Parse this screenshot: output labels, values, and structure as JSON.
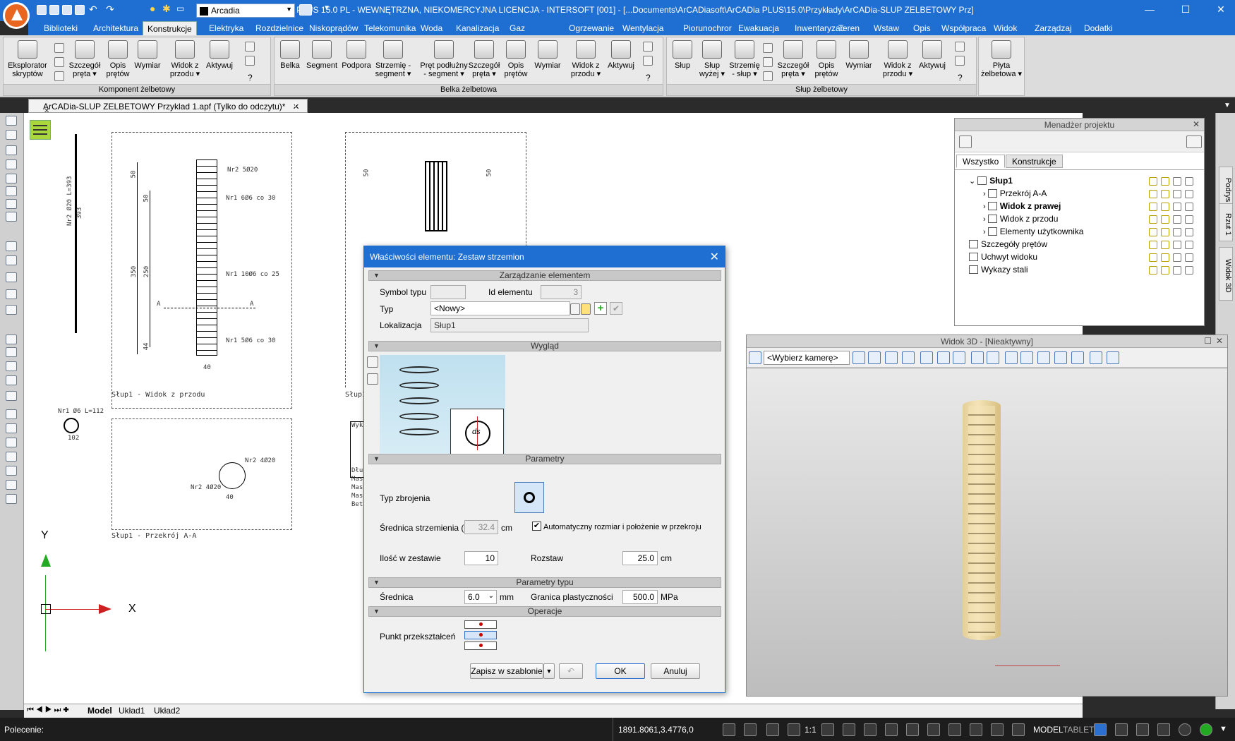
{
  "app": {
    "title": "ArCADia PLUS 15.0 PL - WEWNĘTRZNA, NIEKOMERCYJNA LICENCJA - INTERSOFT [001] - [...Documents\\ArCADiasoft\\ArCADia PLUS\\15.0\\Przykłady\\ArCADia-SLUP ZELBETOWY Prz]",
    "layer": "Arcadia"
  },
  "menu": [
    "Biblioteki",
    "Architektura",
    "Konstrukcje",
    "Elektryka",
    "Rozdzielnice",
    "Niskoprądów",
    "Telekomunika",
    "Woda",
    "Kanalizacja",
    "Gaz",
    "Ogrzewanie",
    "Wentylacja",
    "Piorunochror",
    "Ewakuacja",
    "Inwentaryzac",
    "Teren",
    "Wstaw",
    "Opis",
    "Współpraca",
    "Widok",
    "Zarządzaj",
    "Dodatki"
  ],
  "ribbon": {
    "g1": {
      "label": "Komponent żelbetowy",
      "b1": "Eksplorator",
      "b1b": "skryptów",
      "b2": "Szczegół",
      "b2b": "pręta ▾",
      "b3": "Opis",
      "b3b": "prętów",
      "b4": "Wymiar",
      "b5": "Widok z",
      "b5b": "przodu ▾",
      "b6": "Aktywuj",
      "b7": "?"
    },
    "g2": {
      "label": "Belka żelbetowa",
      "b1": "Belka",
      "b2": "Segment",
      "b3": "Podpora",
      "b4": "Strzemię -",
      "b4b": "segment ▾",
      "b5": "Pręt podłużny",
      "b5b": "- segment ▾",
      "b6": "Szczegół",
      "b6b": "pręta ▾",
      "b7": "Opis",
      "b7b": "prętów",
      "b8": "Wymiar",
      "b9": "Widok z",
      "b9b": "przodu ▾",
      "b10": "Aktywuj",
      "b11": "?"
    },
    "g3": {
      "label": "Słup żelbetowy",
      "b1": "Słup",
      "b2": "Słup",
      "b2b": "wyżej ▾",
      "b3": "Strzemię",
      "b3b": "- słup ▾",
      "b4": "Szczegół",
      "b4b": "pręta ▾",
      "b5": "Opis",
      "b5b": "prętów",
      "b6": "Wymiar",
      "b7": "Widok z",
      "b7b": "przodu ▾",
      "b8": "Aktywuj",
      "b9": "?"
    },
    "g4": {
      "b1": "Płyta",
      "b1b": "żelbetowa ▾"
    }
  },
  "doc_tab": "ArCADia-SLUP ZELBETOWY Przyklad 1.apf (Tylko do odczytu)*",
  "drawing": {
    "front_caption": "Słup1 - Widok z przodu",
    "right_caption": "Słup1",
    "section_caption": "Słup1 - Przekrój A-A",
    "dim_350": "350",
    "dim_250": "250",
    "dim_50a": "50",
    "dim_50b": "50",
    "dim_44": "44",
    "dim_40": "40",
    "dim_40b": "40",
    "n1": "Nr2 5Ø20",
    "n2": "Nr1 6Ø6 co 30",
    "n3": "Nr1 10Ø6 co 25",
    "n4": "Nr1 5Ø6 co 30",
    "vbar": "Nr2 Ø20 L=393",
    "vbar2": "393",
    "ring": "Nr1 Ø6 L=112",
    "ring2": "102",
    "sec_a": "A",
    "sec_b": "A",
    "s1": "Nr2 4Ø20",
    "s2": "Nr2 4Ø20",
    "tbl": "Wyk",
    "tbl2": "Dłu",
    "tbl3": "Mas",
    "tbl4": "Mas",
    "tbl5": "Mas",
    "tbl6": "Bet",
    "axis_y": "Y",
    "axis_x": "X"
  },
  "project_manager": {
    "title": "Menadżer projektu",
    "tabs": [
      "Wszystko",
      "Konstrukcje"
    ],
    "items": [
      "Słup1",
      "Przekrój A-A",
      "Widok z prawej",
      "Widok z przodu",
      "Elementy użytkownika",
      "Szczegóły prętów",
      "Uchwyt widoku",
      "Wykazy stali"
    ]
  },
  "right_tabs": [
    "Podrys",
    "Rzut 1",
    "Widok 3D"
  ],
  "view3d": {
    "title": "Widok 3D - [Nieaktywny]",
    "camera": "<Wybierz kamerę>"
  },
  "dialog": {
    "title": "Właściwości elementu: Zestaw strzemion",
    "sec_mgmt": "Zarządzanie elementem",
    "symbol_label": "Symbol typu",
    "symbol_value": "",
    "id_label": "Id elementu",
    "id_value": "3",
    "type_label": "Typ",
    "type_value": "<Nowy>",
    "loc_label": "Lokalizacja",
    "loc_value": "Słup1",
    "sec_look": "Wygląd",
    "ds_label": "ds",
    "sec_params": "Parametry",
    "rebar_type_label": "Typ zbrojenia",
    "diam_label": "Średnica strzemienia (ds)",
    "diam_value": "32.4",
    "diam_unit": "cm",
    "auto_label": "Automatyczny rozmiar i położenie w przekroju",
    "count_label": "Ilość w zestawie",
    "count_value": "10",
    "spacing_label": "Rozstaw",
    "spacing_value": "25.0",
    "spacing_unit": "cm",
    "sec_type": "Parametry typu",
    "d_label": "Średnica",
    "d_value": "6.0",
    "d_unit": "mm",
    "yield_label": "Granica plastyczności",
    "yield_value": "500.0",
    "yield_unit": "MPa",
    "sec_ops": "Operacje",
    "point_label": "Punkt przekształceń",
    "save_tpl": "Zapisz w szablonie",
    "ok": "OK",
    "cancel": "Anuluj"
  },
  "layout_tabs": [
    "Model",
    "Układ1",
    "Układ2"
  ],
  "status": {
    "command": "Polecenie:",
    "coords": "1891.8061,3.4776,0",
    "scale": "1:1",
    "model": "MODEL",
    "tablet": "TABLET"
  }
}
